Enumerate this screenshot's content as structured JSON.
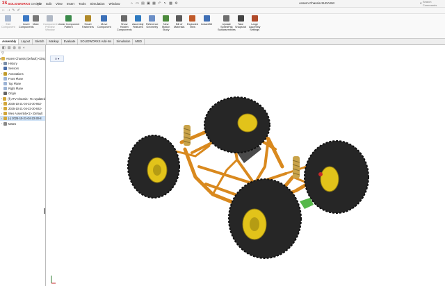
{
  "app": {
    "logo_mark": "3S",
    "logo_text": "SOLIDWORKS",
    "logo_sub": "Design"
  },
  "menu": [
    "File",
    "Edit",
    "View",
    "Insert",
    "Tools",
    "Simulation",
    "Window"
  ],
  "document_title": "Assem Chassis.SLDASM",
  "search": {
    "placeholder": "Search Commands"
  },
  "commands": [
    {
      "label": "Edit\nComponent",
      "disabled": true,
      "icon": "edit-component-icon",
      "color": "#a8b8d0"
    },
    {
      "label": "Insert\nComponents",
      "disabled": false,
      "icon": "insert-components-icon",
      "color": "#3b78c4"
    },
    {
      "label": "Mate",
      "disabled": false,
      "icon": "mate-icon",
      "color": "#777777"
    },
    {
      "label": "Component\nPreview\nWindow",
      "disabled": true,
      "icon": "preview-window-icon",
      "color": "#b0b8c4"
    },
    {
      "label": "Linear Component\nPattern",
      "disabled": false,
      "icon": "linear-pattern-icon",
      "color": "#3a8a4a"
    },
    {
      "label": "Smart\nFasteners",
      "disabled": false,
      "icon": "smart-fasteners-icon",
      "color": "#b08a2a"
    },
    {
      "label": "Move\nComponent",
      "disabled": false,
      "icon": "move-component-icon",
      "color": "#3c70b8"
    },
    {
      "label": "Show\nHidden\nComponents",
      "disabled": false,
      "icon": "show-hidden-icon",
      "color": "#6a6a6a"
    },
    {
      "label": "Assembly\nFeatures",
      "disabled": false,
      "icon": "assembly-features-icon",
      "color": "#2f7ac0"
    },
    {
      "label": "Reference\nGeometry",
      "disabled": false,
      "icon": "reference-geometry-icon",
      "color": "#6b8fc7"
    },
    {
      "label": "New\nMotion\nStudy",
      "disabled": false,
      "icon": "motion-study-icon",
      "color": "#4c8a3c"
    },
    {
      "label": "Bill of\nMaterials",
      "disabled": false,
      "icon": "bom-icon",
      "color": "#5b5b5b"
    },
    {
      "label": "Exploded\nView",
      "disabled": false,
      "icon": "exploded-view-icon",
      "color": "#c05a2a"
    },
    {
      "label": "Instant3D",
      "disabled": false,
      "icon": "instant3d-icon",
      "color": "#3f6fb5"
    },
    {
      "label": "Update\nSpeedPak\nSubassemblies",
      "disabled": false,
      "icon": "speedpak-icon",
      "color": "#6f6f6f"
    },
    {
      "label": "Take\nSnapshot",
      "disabled": false,
      "icon": "snapshot-icon",
      "color": "#444444"
    },
    {
      "label": "Large\nAssembly\nSettings",
      "disabled": false,
      "icon": "large-assembly-icon",
      "color": "#b04a2a"
    }
  ],
  "tabs": [
    "Assembly",
    "Layout",
    "Sketch",
    "Markup",
    "Evaluate",
    "SOLIDWORKS Add-Ins",
    "Simulation",
    "MBD"
  ],
  "active_tab": "Assembly",
  "tree": [
    {
      "label": "Assem Chassis (Default) <Displ",
      "toggle": "▾",
      "color": "#d9b24a"
    },
    {
      "label": "History",
      "toggle": "›",
      "color": "#7a8ea8"
    },
    {
      "label": "Sensors",
      "toggle": "",
      "color": "#4a6ea8"
    },
    {
      "label": "Annotations",
      "toggle": "›",
      "color": "#c09a2a"
    },
    {
      "label": "Front Plane",
      "toggle": "",
      "color": "#9bb3d6"
    },
    {
      "label": "Top Plane",
      "toggle": "",
      "color": "#9bb3d6"
    },
    {
      "label": "Right Plane",
      "toggle": "",
      "color": "#9bb3d6"
    },
    {
      "label": "Origin",
      "toggle": "",
      "color": "#666666"
    },
    {
      "label": "(f) ATV Chassis - R1 Updated",
      "toggle": "›",
      "color": "#d2a63a"
    },
    {
      "label": "2025-10-21-04-23-30-852-",
      "toggle": "›",
      "color": "#d2a63a"
    },
    {
      "label": "2025-10-21-04-23-30-842-",
      "toggle": "›",
      "color": "#d2a63a"
    },
    {
      "label": "Wes Assembly<1> (Default",
      "toggle": "›",
      "color": "#d2a63a"
    },
    {
      "label": "(-) 2025-10-21-04-23-30-8",
      "toggle": "›",
      "color": "#d2a63a",
      "selected": true
    },
    {
      "label": "Mates",
      "toggle": "›",
      "color": "#888888"
    }
  ],
  "colors": {
    "frame": "#d9891e",
    "tire": "#262626",
    "rim": "#e2c31a",
    "spring": "#c9a34a",
    "accent_green": "#56b84a",
    "brand_red": "#d7232a"
  }
}
